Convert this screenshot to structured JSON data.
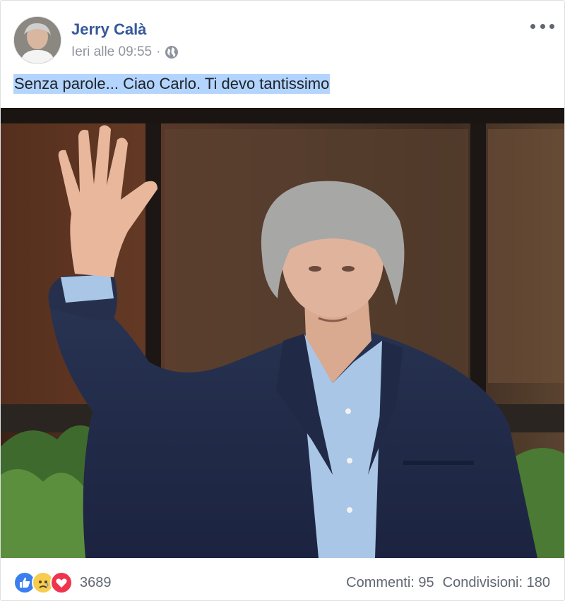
{
  "post": {
    "author": "Jerry Calà",
    "timestamp": "Ieri alle 09:55",
    "separator": "·",
    "privacy_icon": "globe-icon",
    "caption": "Senza parole... Ciao Carlo. Ti devo tantissimo"
  },
  "footer": {
    "reaction_icons": [
      "like-icon",
      "sad-icon",
      "love-icon"
    ],
    "reaction_count": "3689",
    "comments": "Commenti: 95",
    "shares": "Condivisioni: 180"
  },
  "colors": {
    "author_link": "#365899",
    "meta_text": "#90949c",
    "selection_highlight": "#b3d4fc",
    "like": "#3b7ef0",
    "sad": "#f6cd4e",
    "love": "#f0344d"
  }
}
